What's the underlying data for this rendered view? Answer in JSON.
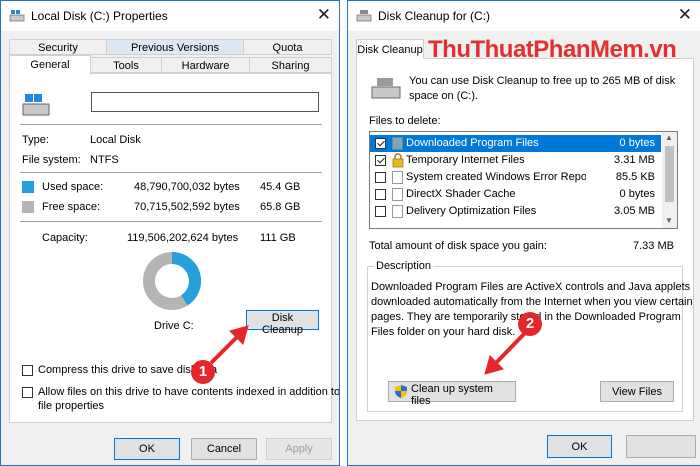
{
  "left_window": {
    "title": "Local Disk (C:) Properties",
    "tabs_row1": [
      "Security",
      "Previous Versions",
      "Quota"
    ],
    "tabs_row2": [
      "General",
      "Tools",
      "Hardware",
      "Sharing"
    ],
    "type_label": "Type:",
    "type_value": "Local Disk",
    "fs_label": "File system:",
    "fs_value": "NTFS",
    "used_label": "Used space:",
    "used_bytes": "48,790,700,032 bytes",
    "used_gb": "45.4 GB",
    "free_label": "Free space:",
    "free_bytes": "70,715,502,592 bytes",
    "free_gb": "65.8 GB",
    "capacity_label": "Capacity:",
    "capacity_bytes": "119,506,202,624 bytes",
    "capacity_gb": "111 GB",
    "drive_label": "Drive C:",
    "disk_cleanup_label": "Disk Cleanup",
    "compress_label": "Compress this drive to save disk spa",
    "index_label_1": "Allow files on this drive to have contents indexed in addition to",
    "index_label_2": "file properties",
    "ok_label": "OK",
    "cancel_label": "Cancel",
    "apply_label": "Apply",
    "used_color": "#26a0da",
    "free_color": "#b4b4b4",
    "used_fraction": 0.408
  },
  "right_window": {
    "title": "Disk Cleanup for  (C:)",
    "tab": "Disk Cleanup",
    "watermark": "ThuThuatPhanMem.vn",
    "info_line1": "You can use Disk Cleanup to free up to 265 MB of disk",
    "info_line2": "space on  (C:).",
    "files_label": "Files to delete:",
    "files": [
      {
        "name": "Downloaded Program Files",
        "size": "0 bytes",
        "checked": true
      },
      {
        "name": "Temporary Internet Files",
        "size": "3.31 MB",
        "checked": true
      },
      {
        "name": "System created Windows Error Reporti...",
        "size": "85.5 KB",
        "checked": false
      },
      {
        "name": "DirectX Shader Cache",
        "size": "0 bytes",
        "checked": false
      },
      {
        "name": "Delivery Optimization Files",
        "size": "3.05 MB",
        "checked": false
      }
    ],
    "total_label": "Total amount of disk space you gain:",
    "total_value": "7.33 MB",
    "description_label": "Description",
    "desc_line1": "Downloaded Program Files are ActiveX controls and Java applets",
    "desc_line2": "downloaded automatically from the Internet when you view certain",
    "desc_line3": "pages. They are temporarily stored in the Downloaded Program",
    "desc_line4": "Files folder on your hard disk.",
    "clean_system_label": "Clean up system files",
    "view_files_label": "View Files",
    "ok_label": "OK"
  },
  "annotations": {
    "badge1": "1",
    "badge2": "2",
    "arrow_color": "#e5262b"
  }
}
